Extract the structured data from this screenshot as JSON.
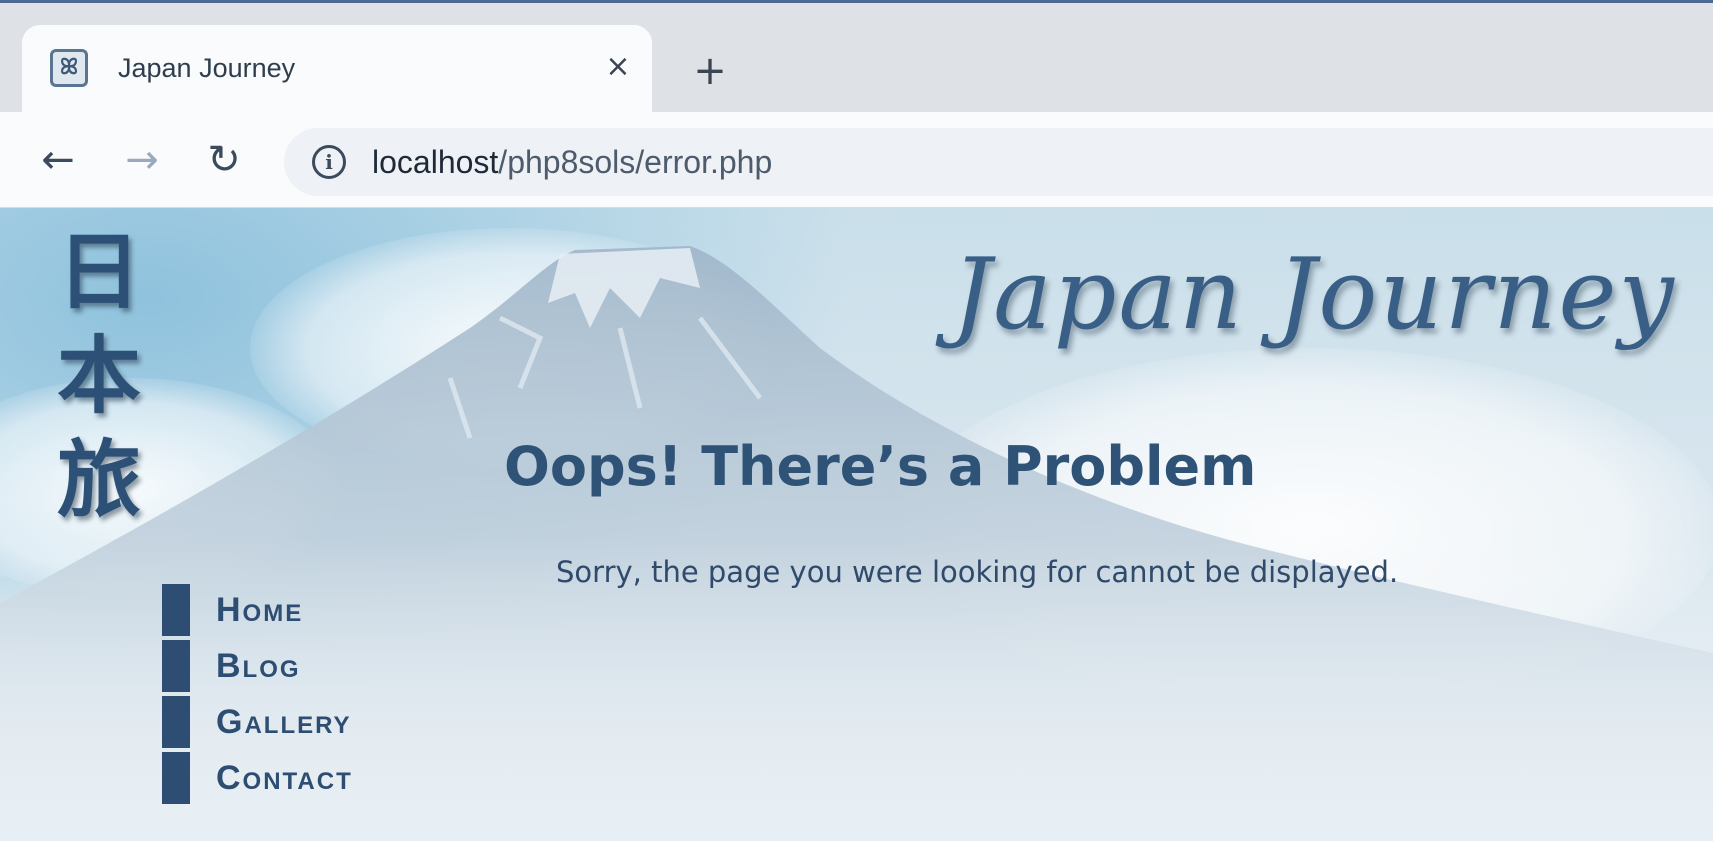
{
  "browser": {
    "tab": {
      "title": "Japan Journey",
      "favicon": "xampp-favicon-icon"
    },
    "icons": {
      "close": "×",
      "new_tab": "+",
      "back": "←",
      "forward": "→",
      "reload": "↻",
      "info": "i",
      "favicon_glyph": "ꕤ"
    },
    "url": {
      "host": "localhost",
      "path": "/php8sols/error.php"
    }
  },
  "page": {
    "kanji": [
      "日",
      "本",
      "旅"
    ],
    "logo_text": "Japan Journey",
    "heading": "Oops! There’s a Problem",
    "message": "Sorry, the page you were looking for cannot be displayed.",
    "nav": [
      "Home",
      "Blog",
      "Gallery",
      "Contact"
    ]
  },
  "colors": {
    "accent": "#2d4d73",
    "heading": "#2f5277",
    "logo": "#3a5f86",
    "sky": "#8fc2dd"
  }
}
